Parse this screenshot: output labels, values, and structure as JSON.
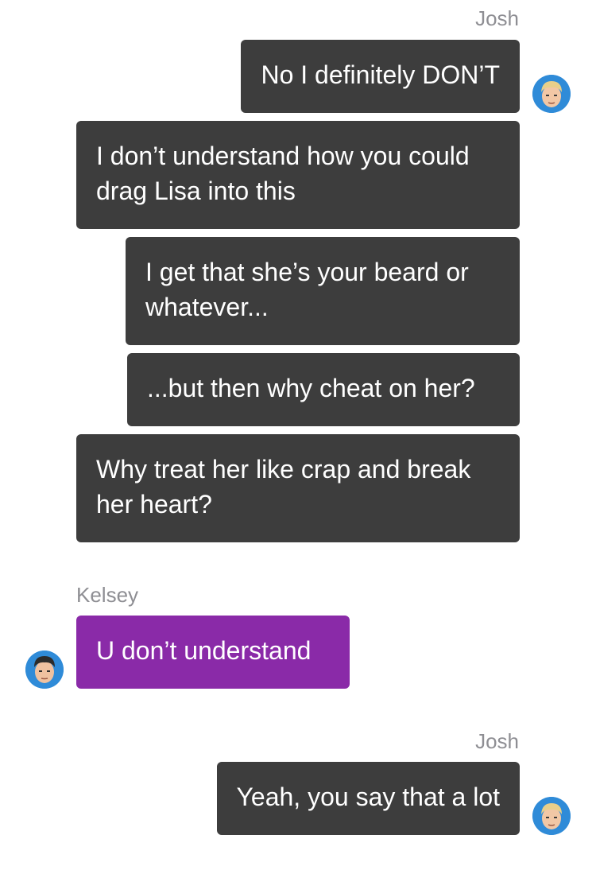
{
  "conversation": {
    "groups": [
      {
        "sender": "Josh",
        "messages": [
          "No I definitely DON’T",
          "I don’t understand how you could\ndrag Lisa into this",
          "I get that she’s your beard or\nwhatever...",
          "...but then why cheat on her?",
          "Why treat her like crap and break\nher heart?"
        ]
      },
      {
        "sender": "Kelsey",
        "messages": [
          "U don’t understand"
        ]
      },
      {
        "sender": "Josh",
        "messages": [
          "Yeah, you say that a lot"
        ]
      }
    ]
  },
  "colors": {
    "josh_bubble": "#3d3d3d",
    "kelsey_bubble": "#8a2aa8",
    "avatar_ring": "#2f8bd8",
    "sender_label": "#8e8e93"
  },
  "icons": {
    "josh_avatar": "blond-man-avatar-icon",
    "kelsey_avatar": "dark-hair-man-avatar-icon"
  }
}
